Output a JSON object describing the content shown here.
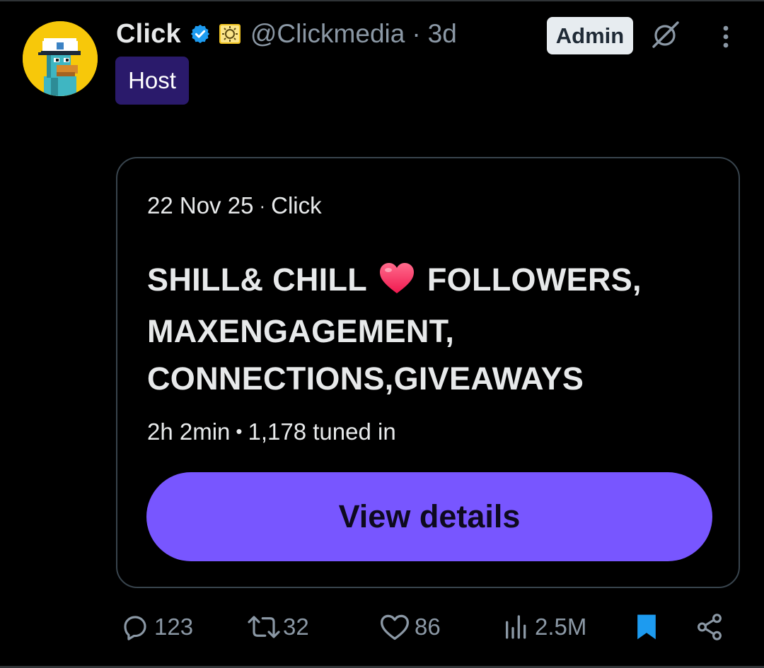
{
  "post": {
    "author": {
      "display_name": "Click",
      "handle": "@Clickmedia",
      "age": "3d",
      "avatar_icon": "pixel-character-avatar",
      "verified_icon": "verified-badge-icon",
      "affiliation_icon": "affiliate-badge-icon",
      "badge_role": "Admin",
      "host_label": "Host"
    },
    "separator": "·"
  },
  "space": {
    "date": "22 Nov 25",
    "separator": "·",
    "host": "Click",
    "title_part1": "SHILL& CHILL",
    "title_part2": "FOLLOWERS, MAXENGAGEMENT, CONNECTIONS,GIVEAWAYS",
    "duration": "2h 2min",
    "bullet": "•",
    "listeners": "1,178 tuned in",
    "button_label": "View details"
  },
  "actions": {
    "replies": "123",
    "reposts": "32",
    "likes": "86",
    "views": "2.5M"
  },
  "colors": {
    "background": "#000000",
    "accent_purple": "#7856ff",
    "host_badge": "#2a1a6b",
    "verified_blue": "#1d9bf0",
    "bookmark_blue": "#1d9bf0",
    "muted_text": "#8b98a5",
    "heart": "#ff3f6c"
  }
}
